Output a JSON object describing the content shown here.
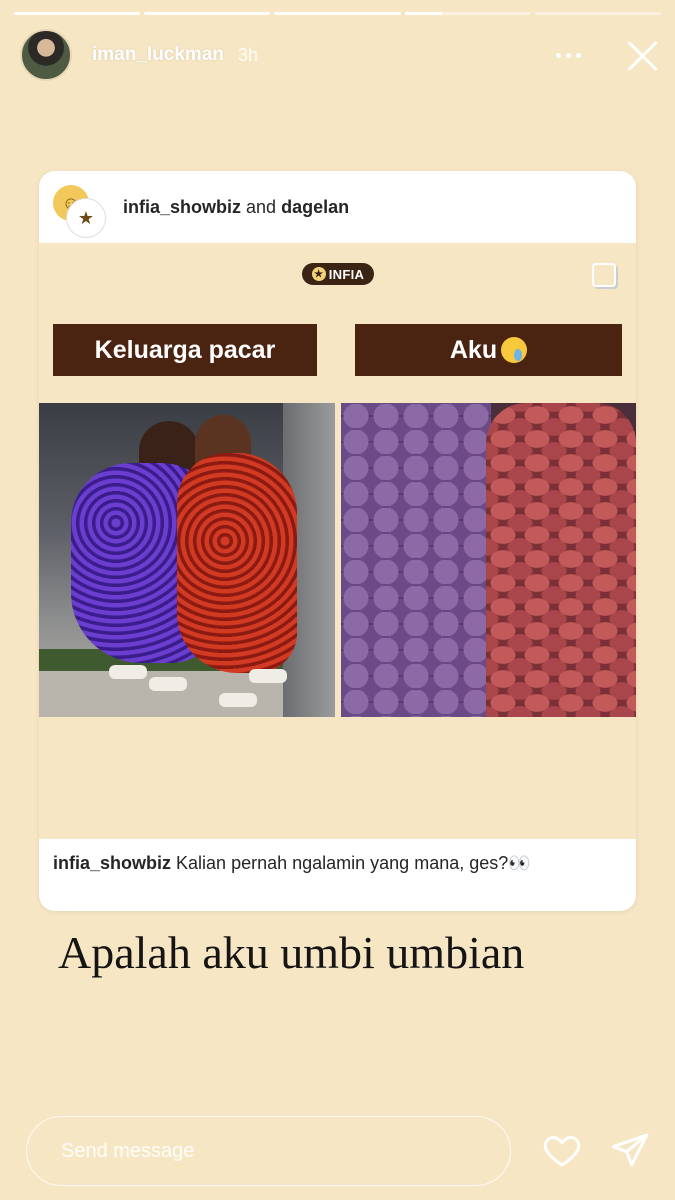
{
  "progress": {
    "segments": [
      1,
      1,
      1,
      0.3,
      0,
      0
    ]
  },
  "story": {
    "username": "iman_luckman",
    "time": "3h"
  },
  "post": {
    "author1": "infia_showbiz",
    "joiner": "and",
    "author2": "dagelan",
    "logo_text": "INFIA",
    "label_left": "Keluarga pacar",
    "label_right": "Aku",
    "caption_author": "infia_showbiz",
    "caption_text": "Kalian pernah ngalamin yang mana, ges?👀"
  },
  "overlay_text": "Apalah aku umbi umbian",
  "message": {
    "placeholder": "Send message"
  }
}
